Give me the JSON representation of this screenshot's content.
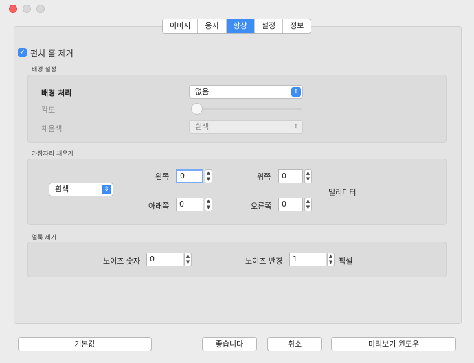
{
  "tabs": [
    "이미지",
    "용지",
    "향상",
    "설정",
    "정보"
  ],
  "active_tab": "향상",
  "hole_punch": {
    "label": "펀치 홀 제거",
    "checked": true
  },
  "background": {
    "section_title": "배경 설정",
    "processing_label": "배경 처리",
    "processing_value": "없음",
    "sensitivity_label": "감도",
    "fill_color_label": "채움색",
    "fill_color_value": "흰색"
  },
  "edge_fill": {
    "section_title": "가장자리 채우기",
    "color_value": "흰색",
    "left_label": "왼쪽",
    "left_value": "0",
    "top_label": "위쪽",
    "top_value": "0",
    "bottom_label": "아래쪽",
    "bottom_value": "0",
    "right_label": "오른쪽",
    "right_value": "0",
    "unit": "밀리미터"
  },
  "speckle": {
    "section_title": "얼룩 제거",
    "noise_count_label": "노이즈 숫자",
    "noise_count_value": "0",
    "noise_radius_label": "노이즈 반경",
    "noise_radius_value": "1",
    "unit": "픽셀"
  },
  "buttons": {
    "defaults": "기본값",
    "ok": "좋습니다",
    "cancel": "취소",
    "preview": "미리보기 윈도우"
  },
  "colors": {
    "accent": "#3d8df5",
    "close": "#fc605c"
  },
  "icons": {
    "check": "checkmark-icon",
    "popup_arrow": "up-down-chevron-icon",
    "stepper": "stepper-arrows-icon"
  }
}
